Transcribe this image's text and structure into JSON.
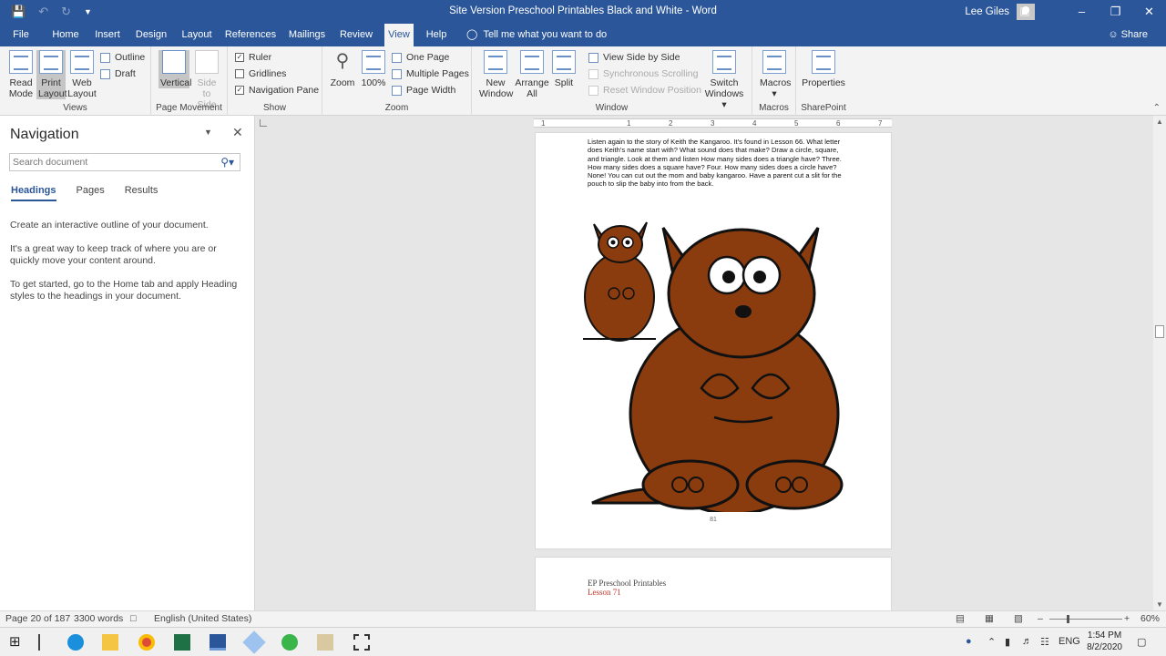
{
  "window": {
    "title": "Site Version Preschool Printables Black and White  -  Word",
    "user": "Lee Giles"
  },
  "quick_access": {
    "save_icon": "save-icon",
    "undo_icon": "undo-icon",
    "redo_icon": "redo-icon",
    "customize_icon": "customize-icon"
  },
  "tabs": [
    "File",
    "Home",
    "Insert",
    "Design",
    "Layout",
    "References",
    "Mailings",
    "Review",
    "View",
    "Help"
  ],
  "active_tab": "View",
  "tell_me": "Tell me what you want to do",
  "share": "Share",
  "ribbon": {
    "views": {
      "label": "Views",
      "read_mode": "Read\nMode",
      "print_layout": "Print\nLayout",
      "web_layout": "Web\nLayout",
      "outline": "Outline",
      "draft": "Draft"
    },
    "page_movement": {
      "label": "Page Movement",
      "vertical": "Vertical",
      "side_to_side": "Side\nto Side"
    },
    "show": {
      "label": "Show",
      "ruler": "Ruler",
      "gridlines": "Gridlines",
      "navigation_pane": "Navigation Pane",
      "ruler_checked": true,
      "gridlines_checked": false,
      "navigation_checked": true
    },
    "zoom": {
      "label": "Zoom",
      "zoom": "Zoom",
      "hundred": "100%",
      "one_page": "One Page",
      "multiple_pages": "Multiple Pages",
      "page_width": "Page Width"
    },
    "window": {
      "label": "Window",
      "new_window": "New\nWindow",
      "arrange_all": "Arrange\nAll",
      "split": "Split",
      "view_side_by_side": "View Side by Side",
      "synchronous_scrolling": "Synchronous Scrolling",
      "reset_window_position": "Reset Window Position",
      "switch_windows": "Switch\nWindows ▾"
    },
    "macros": {
      "label": "Macros",
      "macros": "Macros\n▾"
    },
    "sharepoint": {
      "label": "SharePoint",
      "properties": "Properties"
    }
  },
  "navigation": {
    "title": "Navigation",
    "search_placeholder": "Search document",
    "tabs": [
      "Headings",
      "Pages",
      "Results"
    ],
    "active_tab": "Headings",
    "messages": [
      "Create an interactive outline of your document.",
      "It's a great way to keep track of where you are or quickly move your content around.",
      "To get started, go to the Home tab and apply Heading styles to the headings in your document."
    ]
  },
  "document": {
    "ruler_numbers": [
      "1",
      "1",
      "2",
      "3",
      "4",
      "5",
      "6",
      "7"
    ],
    "paragraph": "Listen again to the story of Keith the Kangaroo. It's found in Lesson 66. What letter does Keith's name start with? What sound does that make? Draw a circle, square, and triangle. Look at them and listen How many sides does a triangle have? Three. How many sides does a square have? Four. How many sides does a circle have? None! You can cut out the mom and baby kangaroo. Have a parent cut a slit for the pouch to slip the baby into from the back.",
    "page_number": "81",
    "next_page_heading": "EP Preschool Printables",
    "next_page_lesson": "Lesson 71",
    "colors": {
      "kangaroo_body": "#8b3c0f",
      "kangaroo_dark": "#5e2606",
      "outline": "#111111"
    }
  },
  "status": {
    "page": "Page 20 of 187",
    "words": "3300 words",
    "language": "English (United States)",
    "zoom": "60%",
    "zoom_fraction": 0.25
  },
  "taskbar": {
    "lang": "ENG",
    "time": "1:54 PM",
    "date": "8/2/2020"
  },
  "colors": {
    "accent": "#2b579a"
  }
}
